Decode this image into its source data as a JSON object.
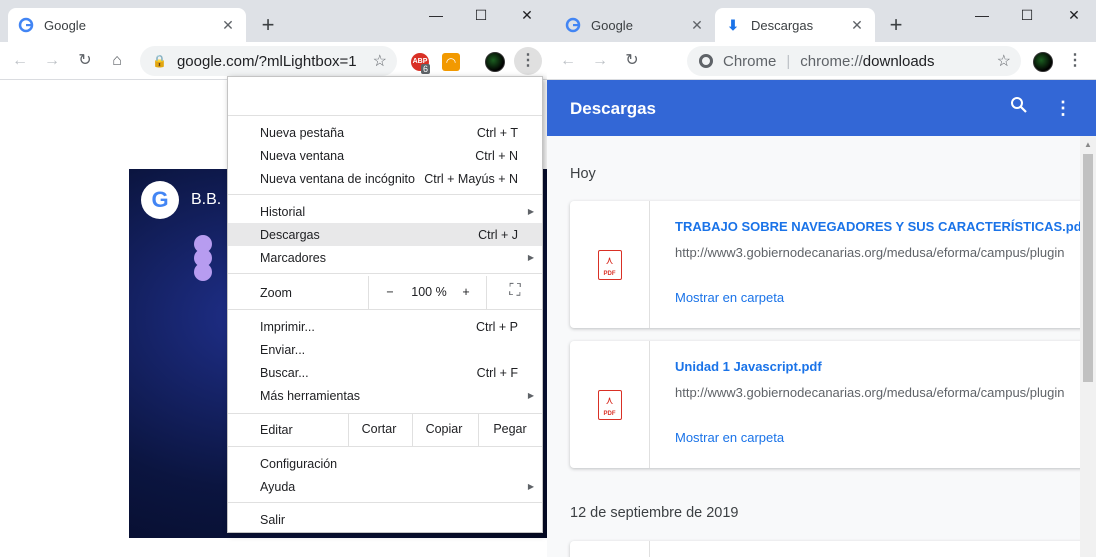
{
  "left": {
    "tab": {
      "title": "Google"
    },
    "address": {
      "url": "google.com/?mlLightbox=1"
    },
    "extension_badge": "6",
    "video": {
      "title": "B.B."
    },
    "menu": {
      "new_tab": {
        "label": "Nueva pestaña",
        "shortcut": "Ctrl + T"
      },
      "new_window": {
        "label": "Nueva ventana",
        "shortcut": "Ctrl + N"
      },
      "incognito": {
        "label": "Nueva ventana de incógnito",
        "shortcut": "Ctrl + Mayús + N"
      },
      "history": {
        "label": "Historial"
      },
      "downloads": {
        "label": "Descargas",
        "shortcut": "Ctrl + J"
      },
      "bookmarks": {
        "label": "Marcadores"
      },
      "zoom": {
        "label": "Zoom",
        "minus": "−",
        "value": "100 %",
        "plus": "+"
      },
      "print": {
        "label": "Imprimir...",
        "shortcut": "Ctrl + P"
      },
      "send": {
        "label": "Enviar..."
      },
      "find": {
        "label": "Buscar...",
        "shortcut": "Ctrl + F"
      },
      "more_tools": {
        "label": "Más herramientas"
      },
      "edit": {
        "label": "Editar",
        "cut": "Cortar",
        "copy": "Copiar",
        "paste": "Pegar"
      },
      "settings": {
        "label": "Configuración"
      },
      "help": {
        "label": "Ayuda"
      },
      "exit": {
        "label": "Salir"
      }
    }
  },
  "right": {
    "tabs": [
      {
        "title": "Google"
      },
      {
        "title": "Descargas"
      }
    ],
    "address": {
      "prefix": "Chrome",
      "scheme": "chrome://",
      "path": "downloads"
    },
    "header": {
      "title": "Descargas"
    },
    "groups": [
      {
        "date": "Hoy",
        "items": [
          {
            "name": "TRABAJO SOBRE NAVEGADORES Y SUS CARACTERÍSTICAS.pdf",
            "url": "http://www3.gobiernodecanarias.org/medusa/eforma/campus/plugin",
            "action": "Mostrar en carpeta",
            "type": "PDF"
          },
          {
            "name": "Unidad 1 Javascript.pdf",
            "url": "http://www3.gobiernodecanarias.org/medusa/eforma/campus/plugin",
            "action": "Mostrar en carpeta",
            "type": "PDF"
          }
        ]
      },
      {
        "date": "12 de septiembre de 2019",
        "items": []
      }
    ]
  },
  "colors": {
    "header_blue": "#3367d6",
    "link_blue": "#1a73e8",
    "pdf_red": "#d93025"
  }
}
